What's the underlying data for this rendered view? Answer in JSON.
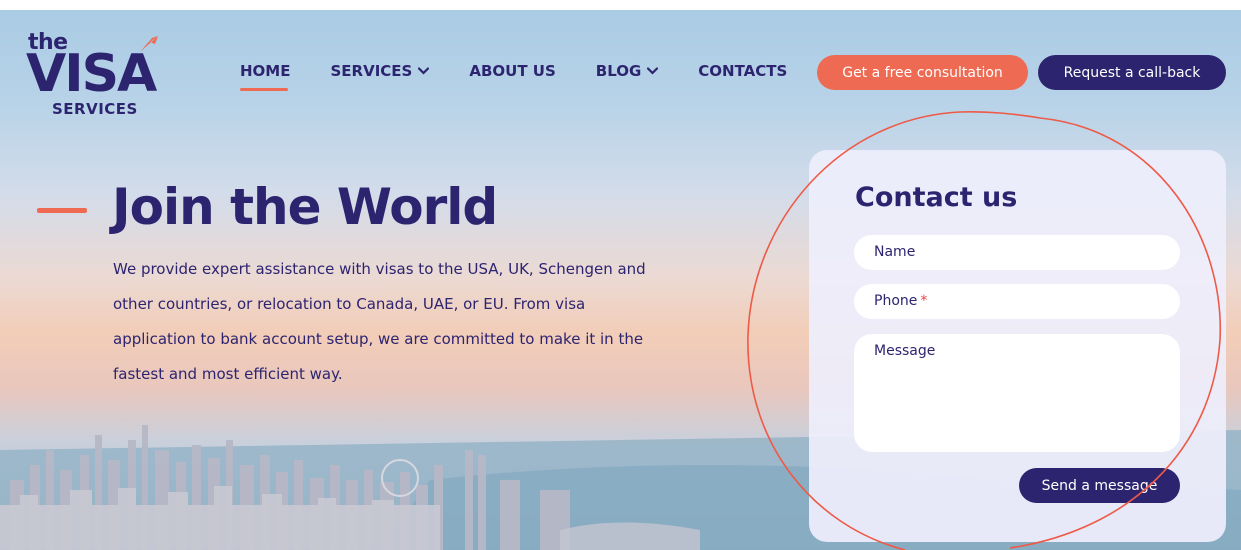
{
  "logo": {
    "top_text": "the",
    "main_text": "VISA",
    "bottom_text": "SERVICES",
    "icon": "plane-icon"
  },
  "nav": {
    "items": [
      {
        "label": "HOME",
        "active": true,
        "dropdown": false
      },
      {
        "label": "SERVICES",
        "active": false,
        "dropdown": true
      },
      {
        "label": "ABOUT US",
        "active": false,
        "dropdown": false
      },
      {
        "label": "BLOG",
        "active": false,
        "dropdown": true
      },
      {
        "label": "CONTACTS",
        "active": false,
        "dropdown": false
      }
    ],
    "dropdown_icon": "chevron-down-icon"
  },
  "header": {
    "consult_label": "Get a free consultation",
    "callback_label": "Request a call-back"
  },
  "hero": {
    "title": "Join the World",
    "text": "We provide expert assistance with visas to the USA, UK, Schengen and other countries, or relocation to Canada, UAE, or EU. From visa application to bank account setup, we are committed to make it in the fastest and most efficient way."
  },
  "contact": {
    "title": "Contact us",
    "name_label": "Name",
    "phone_label": "Phone",
    "required_mark": "*",
    "message_label": "Message",
    "send_label": "Send a message"
  },
  "colors": {
    "brand_navy": "#2d2470",
    "accent_coral": "#ee6a52",
    "required_red": "#e8483d",
    "card_bg": "#eeeefc"
  }
}
